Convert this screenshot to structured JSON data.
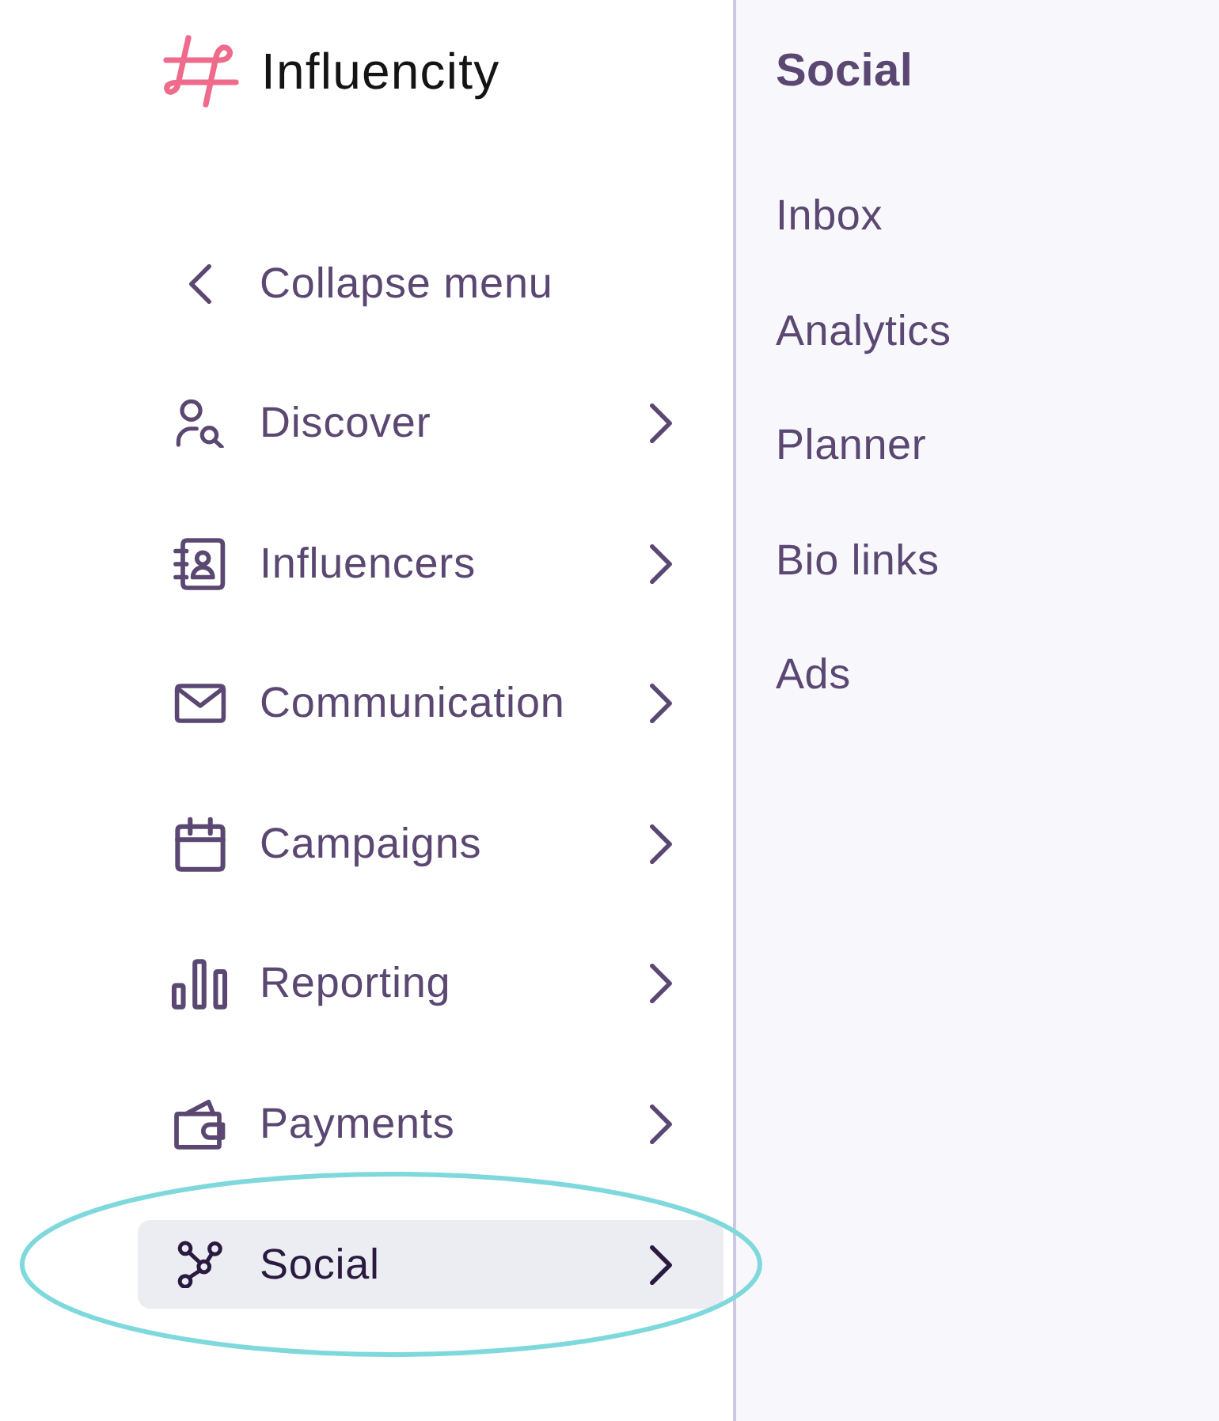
{
  "brand": {
    "name": "Influencity"
  },
  "sidebar": {
    "collapse_button": {
      "label": "Collapse menu"
    },
    "items": [
      {
        "label": "Discover",
        "selected": false
      },
      {
        "label": "Influencers",
        "selected": false
      },
      {
        "label": "Communication",
        "selected": false
      },
      {
        "label": "Campaigns",
        "selected": false
      },
      {
        "label": "Reporting",
        "selected": false
      },
      {
        "label": "Payments",
        "selected": false
      },
      {
        "label": "Social",
        "selected": true
      }
    ]
  },
  "annotation": {
    "kind": "ellipse"
  },
  "submenu": {
    "title": "Social",
    "items": [
      {
        "label": "Inbox",
        "selected": false
      },
      {
        "label": "Analytics",
        "selected": false
      },
      {
        "label": "Planner",
        "selected": false
      },
      {
        "label": "Bio links",
        "selected": false
      },
      {
        "label": "Ads",
        "selected": false
      }
    ]
  }
}
